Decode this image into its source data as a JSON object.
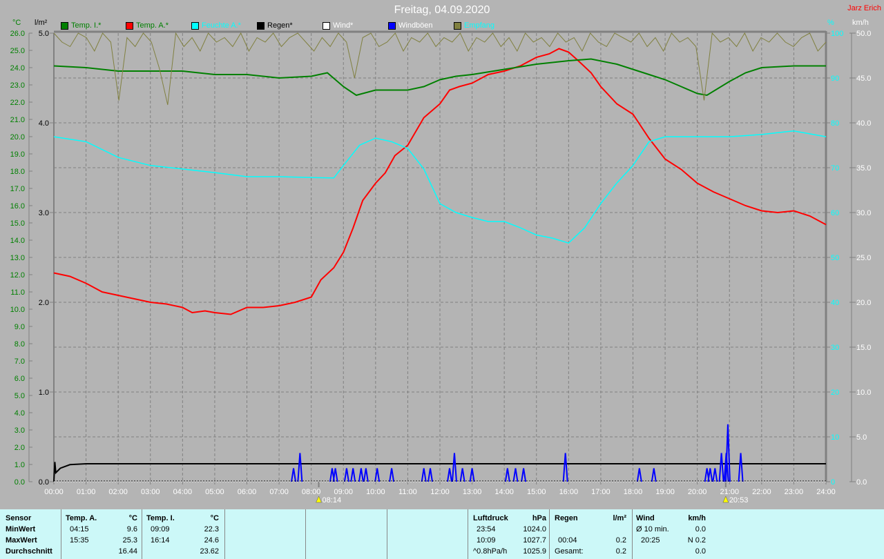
{
  "title": "Freitag, 04.09.2020",
  "author": "Jarz Erich",
  "colors": {
    "temp_i": "#008000",
    "temp_a": "#ff0000",
    "feuchte": "#00ffff",
    "regen": "#000000",
    "wind": "#ffffff",
    "windboeen": "#0000ff",
    "empfang": "#808040"
  },
  "legend": [
    {
      "label": "Temp. I.*",
      "color": "#008000",
      "text_color": "#008000"
    },
    {
      "label": "Temp. A.*",
      "color": "#ff0000",
      "text_color": "#008000"
    },
    {
      "label": "Feuchte A.*",
      "color": "#00ffff",
      "text_color": "#00ffff"
    },
    {
      "label": "Regen*",
      "color": "#000000",
      "text_color": "#000000"
    },
    {
      "label": "Wind*",
      "color": "#ffffff",
      "text_color": "#ffffff"
    },
    {
      "label": "Windböen",
      "color": "#0000ff",
      "text_color": "#ffffff"
    },
    {
      "label": "Empfang",
      "color": "#808040",
      "text_color": "#00ffff"
    }
  ],
  "units": {
    "celsius": "°C",
    "rain": "l/m²",
    "percent": "%",
    "kmh": "km/h"
  },
  "chart_data": {
    "type": "line",
    "title": "Freitag, 04.09.2020",
    "x_ticks": [
      "00:00",
      "01:00",
      "02:00",
      "03:00",
      "04:00",
      "05:00",
      "06:00",
      "07:00",
      "08:00",
      "09:00",
      "10:00",
      "11:00",
      "12:00",
      "13:00",
      "14:00",
      "15:00",
      "16:00",
      "17:00",
      "18:00",
      "19:00",
      "20:00",
      "21:00",
      "22:00",
      "23:00",
      "24:00"
    ],
    "xlim": [
      0,
      24
    ],
    "axes": {
      "celsius": {
        "range": [
          0,
          26
        ],
        "ticks": [
          "0.0",
          "1.0",
          "2.0",
          "3.0",
          "4.0",
          "5.0",
          "6.0",
          "7.0",
          "8.0",
          "9.0",
          "10.0",
          "11.0",
          "12.0",
          "13.0",
          "14.0",
          "15.0",
          "16.0",
          "17.0",
          "18.0",
          "19.0",
          "20.0",
          "21.0",
          "22.0",
          "23.0",
          "24.0",
          "25.0",
          "26.0"
        ]
      },
      "rain": {
        "range": [
          0,
          5
        ],
        "ticks": [
          "0.0",
          "1.0",
          "2.0",
          "3.0",
          "4.0",
          "5.0"
        ]
      },
      "percent": {
        "range": [
          0,
          100
        ],
        "ticks": [
          "0",
          "10",
          "20",
          "30",
          "40",
          "50",
          "60",
          "70",
          "80",
          "90",
          "100"
        ]
      },
      "kmh": {
        "range": [
          0,
          50
        ],
        "ticks": [
          "0.0",
          "5.0",
          "10.0",
          "15.0",
          "20.0",
          "25.0",
          "30.0",
          "35.0",
          "40.0",
          "45.0",
          "50.0"
        ]
      }
    },
    "grid": true,
    "sunrise": "08:14",
    "sunset": "20:53",
    "series": [
      {
        "name": "Temp. A.",
        "axis": "celsius",
        "color": "#ff0000",
        "points": [
          [
            0,
            12.1
          ],
          [
            0.5,
            11.9
          ],
          [
            1,
            11.5
          ],
          [
            1.5,
            11.0
          ],
          [
            2,
            10.8
          ],
          [
            2.5,
            10.6
          ],
          [
            3,
            10.4
          ],
          [
            3.5,
            10.3
          ],
          [
            4,
            10.1
          ],
          [
            4.3,
            9.8
          ],
          [
            4.7,
            9.9
          ],
          [
            5,
            9.8
          ],
          [
            5.5,
            9.7
          ],
          [
            6,
            10.1
          ],
          [
            6.5,
            10.1
          ],
          [
            7,
            10.2
          ],
          [
            7.5,
            10.4
          ],
          [
            8,
            10.7
          ],
          [
            8.3,
            11.7
          ],
          [
            8.7,
            12.4
          ],
          [
            9,
            13.3
          ],
          [
            9.3,
            14.7
          ],
          [
            9.6,
            16.3
          ],
          [
            10,
            17.3
          ],
          [
            10.3,
            17.9
          ],
          [
            10.6,
            18.9
          ],
          [
            11,
            19.5
          ],
          [
            11.5,
            21.1
          ],
          [
            12,
            21.9
          ],
          [
            12.3,
            22.7
          ],
          [
            12.6,
            22.9
          ],
          [
            13,
            23.1
          ],
          [
            13.5,
            23.6
          ],
          [
            14,
            23.8
          ],
          [
            14.5,
            24.1
          ],
          [
            15,
            24.6
          ],
          [
            15.4,
            24.8
          ],
          [
            15.7,
            25.1
          ],
          [
            16,
            24.9
          ],
          [
            16.3,
            24.4
          ],
          [
            16.7,
            23.7
          ],
          [
            17,
            22.9
          ],
          [
            17.5,
            21.9
          ],
          [
            18,
            21.3
          ],
          [
            18.5,
            19.9
          ],
          [
            19,
            18.7
          ],
          [
            19.5,
            18.1
          ],
          [
            20,
            17.3
          ],
          [
            20.5,
            16.8
          ],
          [
            21,
            16.4
          ],
          [
            21.5,
            16.0
          ],
          [
            22,
            15.7
          ],
          [
            22.5,
            15.6
          ],
          [
            23,
            15.7
          ],
          [
            23.5,
            15.4
          ],
          [
            24,
            14.9
          ]
        ]
      },
      {
        "name": "Temp. I.",
        "axis": "celsius",
        "color": "#008000",
        "points": [
          [
            0,
            24.1
          ],
          [
            1,
            24.0
          ],
          [
            2,
            23.8
          ],
          [
            3,
            23.8
          ],
          [
            4,
            23.8
          ],
          [
            5,
            23.6
          ],
          [
            6,
            23.6
          ],
          [
            7,
            23.4
          ],
          [
            8,
            23.5
          ],
          [
            8.5,
            23.7
          ],
          [
            9,
            22.9
          ],
          [
            9.4,
            22.4
          ],
          [
            10,
            22.7
          ],
          [
            11,
            22.7
          ],
          [
            11.5,
            22.9
          ],
          [
            12,
            23.3
          ],
          [
            12.5,
            23.5
          ],
          [
            13,
            23.6
          ],
          [
            14,
            23.9
          ],
          [
            15,
            24.2
          ],
          [
            16,
            24.4
          ],
          [
            16.7,
            24.5
          ],
          [
            17.5,
            24.2
          ],
          [
            18,
            23.9
          ],
          [
            18.5,
            23.6
          ],
          [
            19,
            23.3
          ],
          [
            19.5,
            22.9
          ],
          [
            20,
            22.5
          ],
          [
            20.3,
            22.4
          ],
          [
            21,
            23.2
          ],
          [
            21.5,
            23.7
          ],
          [
            22,
            24.0
          ],
          [
            23,
            24.1
          ],
          [
            24,
            24.1
          ]
        ]
      },
      {
        "name": "Feuchte A.",
        "axis": "percent",
        "color": "#00ffff",
        "points": [
          [
            0,
            76.9
          ],
          [
            1,
            75.8
          ],
          [
            2,
            72.3
          ],
          [
            3,
            70.5
          ],
          [
            4,
            69.7
          ],
          [
            5,
            68.9
          ],
          [
            6,
            68
          ],
          [
            7,
            68
          ],
          [
            8,
            67.8
          ],
          [
            8.7,
            67.7
          ],
          [
            9,
            70.5
          ],
          [
            9.5,
            75
          ],
          [
            10,
            76.6
          ],
          [
            10.5,
            75.8
          ],
          [
            11,
            74.3
          ],
          [
            11.5,
            69.7
          ],
          [
            12,
            62
          ],
          [
            12.5,
            60
          ],
          [
            13,
            58.9
          ],
          [
            13.5,
            58
          ],
          [
            14,
            58
          ],
          [
            14.5,
            56.6
          ],
          [
            15,
            55
          ],
          [
            15.5,
            54.3
          ],
          [
            16,
            53.2
          ],
          [
            16.5,
            56.6
          ],
          [
            17,
            62
          ],
          [
            17.5,
            66.6
          ],
          [
            18,
            70.5
          ],
          [
            18.5,
            75.8
          ],
          [
            19,
            76.9
          ],
          [
            20,
            76.9
          ],
          [
            21,
            76.9
          ],
          [
            22,
            77.4
          ],
          [
            23,
            78.2
          ],
          [
            24,
            76.9
          ]
        ]
      },
      {
        "name": "Regen",
        "axis": "rain",
        "color": "#000000",
        "points": [
          [
            0,
            0
          ],
          [
            0.03,
            0.22
          ],
          [
            0.06,
            0.1
          ],
          [
            0.2,
            0.15
          ],
          [
            0.5,
            0.19
          ],
          [
            1,
            0.2
          ],
          [
            24,
            0.2
          ]
        ]
      },
      {
        "name": "Wind",
        "axis": "kmh",
        "color": "#ffffff",
        "points": [
          [
            0,
            0
          ],
          [
            24,
            0
          ]
        ]
      },
      {
        "name": "Empfang",
        "axis": "percent",
        "color": "#808040",
        "values": [
          100,
          98,
          97,
          100,
          99,
          96,
          100,
          98,
          85,
          99,
          97,
          100,
          98,
          92,
          84,
          100,
          97,
          99,
          96,
          100,
          98,
          99,
          97,
          100,
          96,
          99,
          98,
          100,
          97,
          99,
          100,
          98,
          96,
          99,
          97,
          100,
          98,
          90,
          99,
          100,
          97,
          98,
          100,
          96,
          99,
          98,
          100,
          97,
          99,
          98,
          100,
          96,
          99,
          98,
          100,
          97,
          99,
          96,
          100,
          98,
          99,
          97,
          100,
          98,
          99,
          96,
          100,
          98,
          97,
          100,
          99,
          98,
          100,
          97,
          99,
          96,
          100,
          98,
          99,
          97,
          85,
          100,
          98,
          99,
          97,
          100,
          96,
          99,
          98,
          100,
          98,
          97,
          99,
          100,
          96,
          98
        ]
      },
      {
        "name": "Windböen",
        "axis": "kmh",
        "color": "#0000ff",
        "gusts": [
          [
            7.45,
            1.5
          ],
          [
            7.65,
            3.2
          ],
          [
            8.65,
            1.5
          ],
          [
            8.75,
            1.5
          ],
          [
            9.1,
            1.5
          ],
          [
            9.3,
            1.5
          ],
          [
            9.55,
            1.5
          ],
          [
            9.7,
            1.5
          ],
          [
            10.05,
            1.5
          ],
          [
            10.5,
            1.5
          ],
          [
            11.5,
            1.5
          ],
          [
            11.7,
            1.5
          ],
          [
            12.3,
            1.5
          ],
          [
            12.45,
            3.2
          ],
          [
            12.7,
            1.5
          ],
          [
            13.0,
            1.5
          ],
          [
            14.1,
            1.5
          ],
          [
            14.35,
            1.5
          ],
          [
            14.6,
            1.5
          ],
          [
            15.9,
            3.2
          ],
          [
            18.2,
            1.5
          ],
          [
            18.65,
            1.5
          ],
          [
            20.3,
            1.5
          ],
          [
            20.4,
            1.5
          ],
          [
            20.55,
            1.5
          ],
          [
            20.75,
            3.2
          ],
          [
            20.9,
            3.2
          ],
          [
            20.95,
            6.4
          ],
          [
            21.35,
            3.2
          ]
        ]
      }
    ]
  },
  "stats": {
    "sensor": "Sensor",
    "min": "MinWert",
    "max": "MaxWert",
    "avg": "Durchschnitt",
    "temp_a": {
      "label": "Temp. A.",
      "unit": "°C",
      "min_time": "04:15",
      "min": "9.6",
      "max_time": "15:35",
      "max": "25.3",
      "avg": "16.44"
    },
    "temp_i": {
      "label": "Temp. I.",
      "unit": "°C",
      "min_time": "09:09",
      "min": "22.3",
      "max_time": "16:14",
      "max": "24.6",
      "avg": "23.62"
    },
    "pressure": {
      "label": "Luftdruck",
      "unit": "hPa",
      "min_time": "23:54",
      "min": "1024.0",
      "max_time": "10:09",
      "max": "1027.7",
      "trend": "^0.8hPa/h",
      "avg": "1025.9"
    },
    "rain": {
      "label": "Regen",
      "unit": "l/m²",
      "max_time": "00:04",
      "max": "0.2",
      "total_label": "Gesamt:",
      "total": "0.2"
    },
    "wind": {
      "label": "Wind",
      "unit": "km/h",
      "avg_label": "Ø 10 min.",
      "avg": "0.0",
      "max_time": "20:25",
      "max": "N 0.2",
      "mean": "0.0"
    }
  }
}
